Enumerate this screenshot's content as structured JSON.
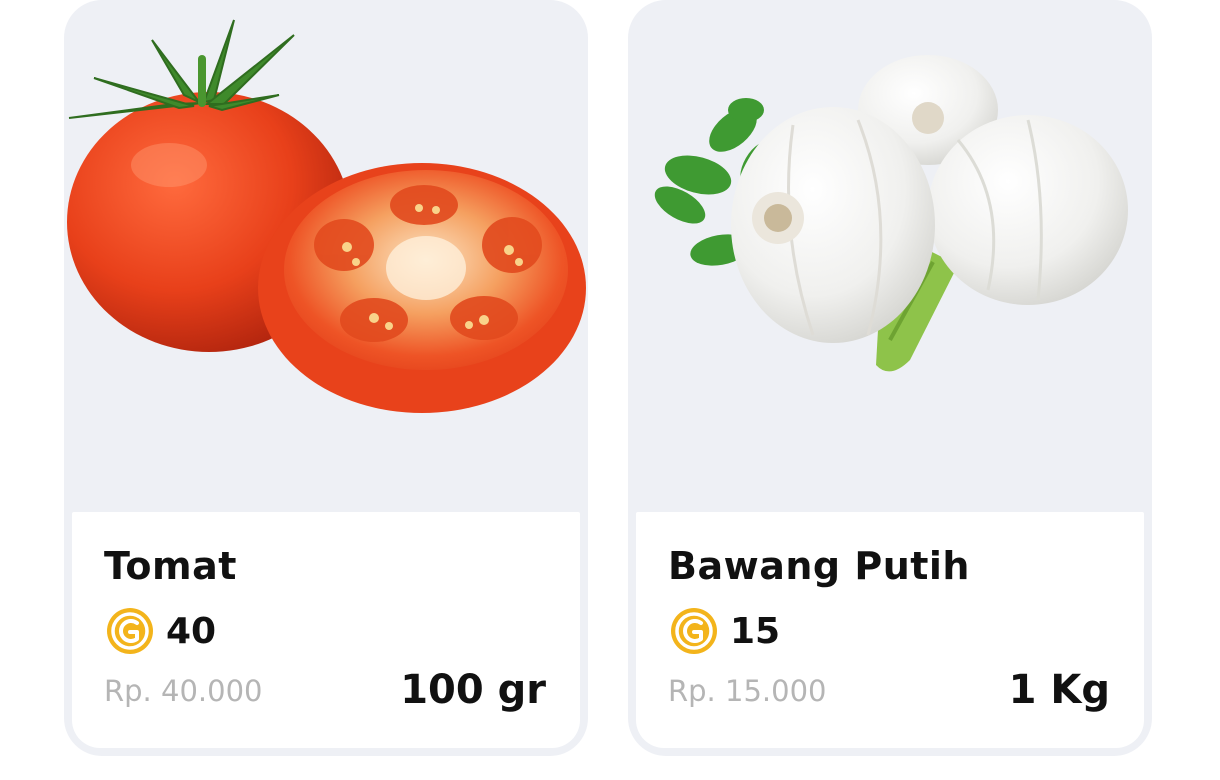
{
  "colors": {
    "card_background": "#eef0f5",
    "info_background": "#ffffff",
    "text_primary": "#111111",
    "text_muted": "#b5b5b5",
    "coin": "#f3b41b"
  },
  "products": [
    {
      "name": "Tomat",
      "image_icon": "tomato-image",
      "points": "40",
      "price": "Rp. 40.000",
      "unit": "100 gr"
    },
    {
      "name": "Bawang Putih",
      "image_icon": "garlic-image",
      "points": "15",
      "price": "Rp. 15.000",
      "unit": "1 Kg"
    }
  ]
}
